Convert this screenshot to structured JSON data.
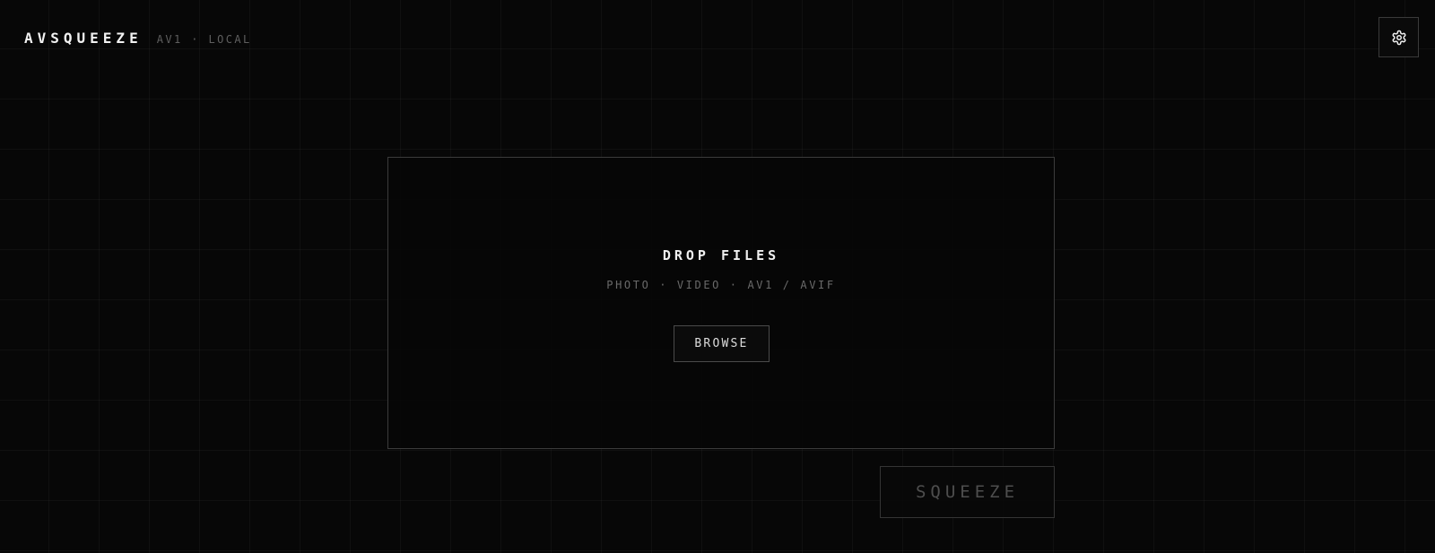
{
  "header": {
    "app_name": "AVSQUEEZE",
    "subtitle": "AV1 · LOCAL",
    "settings_icon": "gear-icon"
  },
  "dropzone": {
    "title": "DROP FILES",
    "formats": "PHOTO · VIDEO · AV1 / AVIF",
    "browse_label": "BROWSE"
  },
  "actions": {
    "squeeze_label": "SQUEEZE",
    "squeeze_enabled": false
  },
  "colors": {
    "background": "#070707",
    "grid_line": "#141414",
    "border": "#3b3b3b",
    "text_primary": "#f0f0f0",
    "text_muted": "#6a6a6a",
    "disabled_text": "#4e4e4e"
  }
}
